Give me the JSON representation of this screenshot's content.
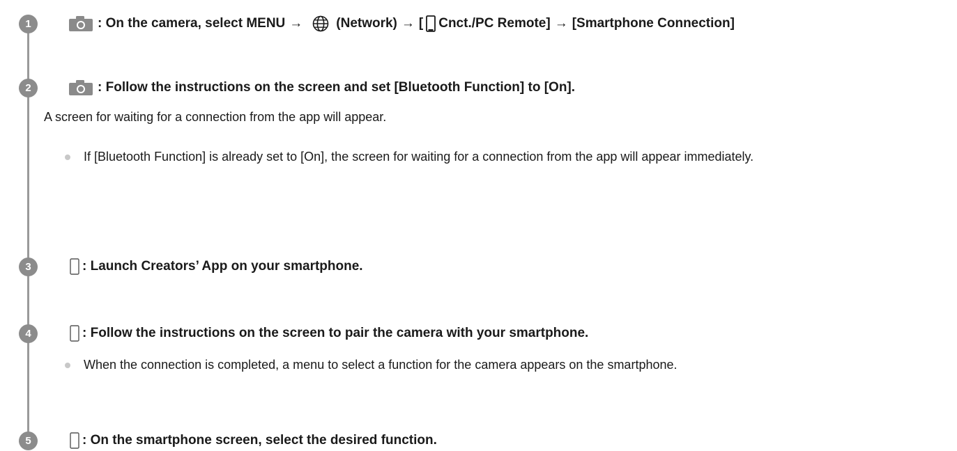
{
  "steps": [
    {
      "number": "1",
      "prefix": ": On the camera, select MENU",
      "arrow": "→",
      "network_label": "(Network)",
      "bracket_open": "[",
      "menu_item": "Cnct./PC Remote]",
      "target": "[Smartphone Connection]"
    },
    {
      "number": "2",
      "text": ": Follow the instructions on the screen and set [Bluetooth Function] to [On].",
      "note": "A screen for waiting for a connection from the app will appear.",
      "bullet": "If [Bluetooth Function] is already set to [On], the screen for waiting for a connection from the app will appear immediately."
    },
    {
      "number": "3",
      "text": ": Launch Creators’ App on your smartphone."
    },
    {
      "number": "4",
      "text": ": Follow the instructions on the screen to pair the camera with your smartphone.",
      "bullet": "When the connection is completed, a menu to select a function for the camera appears on the smartphone."
    },
    {
      "number": "5",
      "text": ": On the smartphone screen, select the desired function."
    }
  ],
  "icons": {
    "camera": "camera-icon",
    "smartphone": "smartphone-icon",
    "network": "globe-icon"
  },
  "colors": {
    "step_badge": "#8c8c8c",
    "timeline": "#9a9a9a",
    "bullet": "#c8c8c8",
    "text": "#1a1a1a"
  }
}
